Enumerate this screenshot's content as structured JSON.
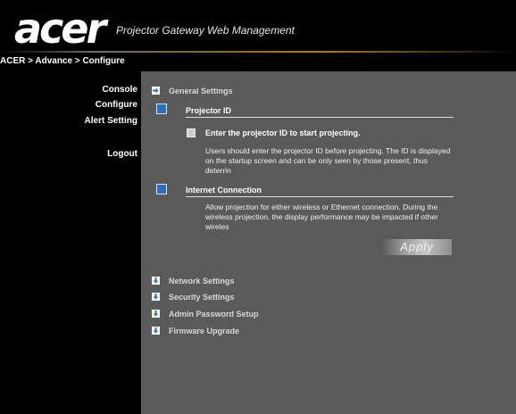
{
  "header": {
    "logo_text": "acer",
    "product_title": "Projector Gateway Web Management"
  },
  "breadcrumb": "ACER > Advance > Configure",
  "sidebar": {
    "items": [
      {
        "label": "Console"
      },
      {
        "label": "Configure"
      },
      {
        "label": "Alert Setting"
      },
      {
        "label": "Logout"
      }
    ]
  },
  "main": {
    "general_settings": "General Settings",
    "projector_id": {
      "title": "Projector ID",
      "checkbox_label": "Enter the projector ID to start projecting.",
      "description": "Users should enter the projector ID before projecting. The ID is displayed on the startup screen and can be only seen by those present, thus deterrin"
    },
    "internet_connection": {
      "title": "Internet Connection",
      "description": "Allow projection for either wireless or Ethernet connection. During the wireless projection, the display performance may be impacted if other wireles"
    },
    "apply_label": "Apply",
    "sections": [
      {
        "label": "Network Settings"
      },
      {
        "label": "Security Settings"
      },
      {
        "label": "Admin Password Setup"
      },
      {
        "label": "Firmware Upgrade"
      }
    ]
  },
  "colors": {
    "panel_bg": "#5a5a5a",
    "accent_blue": "#2e6fb8",
    "header_rule_gold": "#b07d18"
  },
  "icons": {
    "expanded_arrow": "right-arrow-icon",
    "collapsed_arrow": "down-arrow-icon",
    "projector_id_icon": "projector-id-icon",
    "internet_icon": "internet-connection-icon"
  }
}
